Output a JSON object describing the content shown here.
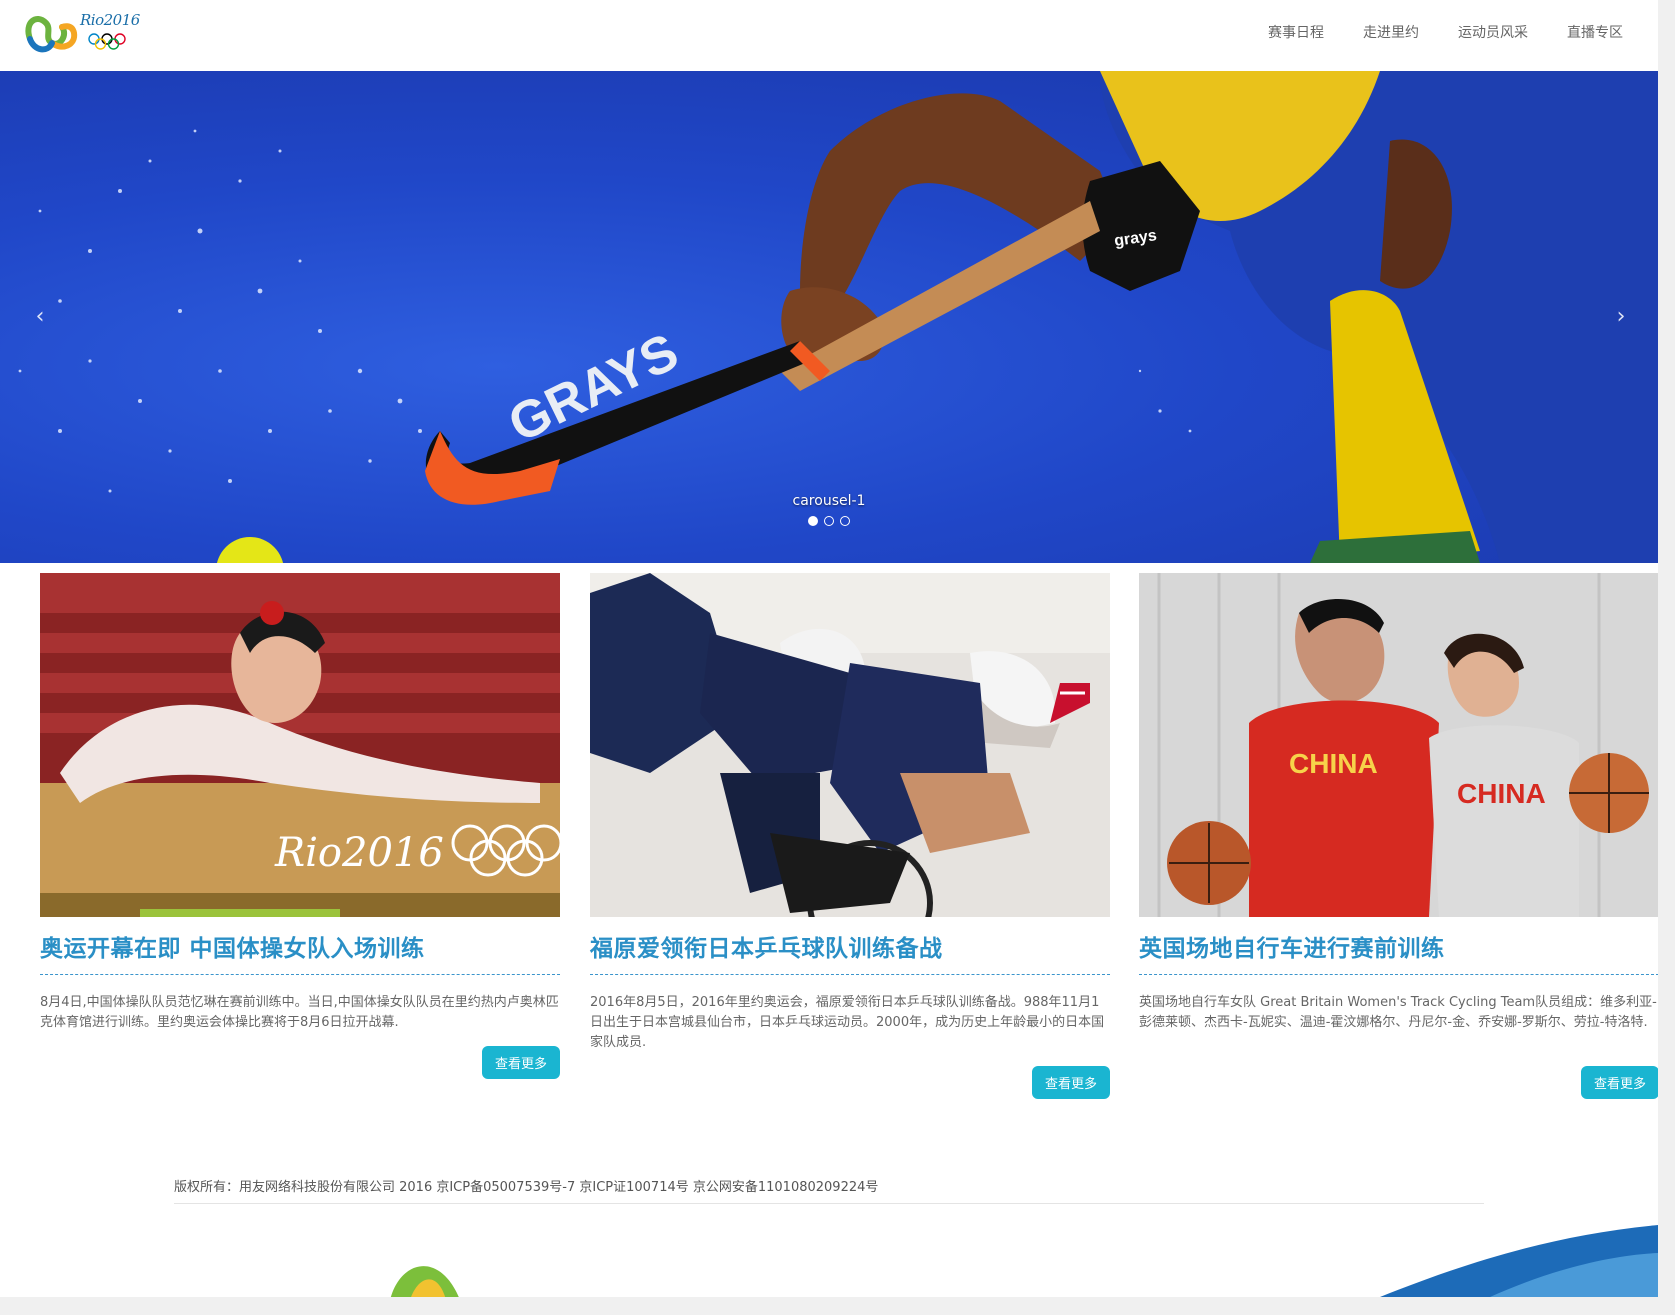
{
  "header": {
    "logo_text": "Rio2016",
    "nav": [
      "赛事日程",
      "走进里约",
      "运动员风采",
      "直播专区"
    ]
  },
  "carousel": {
    "caption": "carousel-1",
    "brand_text": "GRAYS",
    "slide_count": 3,
    "active_index": 0,
    "prev_icon": "chevron-left-icon",
    "next_icon": "chevron-right-icon"
  },
  "cards": [
    {
      "title": "奥运开幕在即 中国体操女队入场训练",
      "body": "8月4日,中国体操队队员范忆琳在赛前训练中。当日,中国体操女队队员在里约热内卢奥林匹克体育馆进行训练。里约奥运会体操比赛将于8月6日拉开战幕.",
      "button": "查看更多",
      "image_text": "Rio2016"
    },
    {
      "title": "福原爱领衔日本乒乓球队训练备战",
      "body": "2016年8月5日，2016年里约奥运会，福原爱领衔日本乒乓球队训练备战。988年11月1日出生于日本宫城县仙台市，日本乒乓球运动员。2000年，成为历史上年龄最小的日本国家队成员.",
      "button": "查看更多"
    },
    {
      "title": "英国场地自行车进行赛前训练",
      "body": "英国场地自行车女队 Great Britain Women's Track Cycling Team队员组成：维多利亚-彭德莱顿、杰西卡-瓦妮实、温迪-霍汶娜格尔、丹尼尔-金、乔安娜-罗斯尔、劳拉-特洛特.",
      "button": "查看更多",
      "image_text": [
        "CHINA",
        "CHINA"
      ]
    }
  ],
  "footer": {
    "copyright": "版权所有：用友网络科技股份有限公司 2016 京ICP备05007539号-7 京ICP证100714号 京公网安备1101080209224号"
  },
  "colors": {
    "accent": "#2a8fc6",
    "button": "#1ab5d1",
    "carousel_bg": "#2047c8"
  }
}
